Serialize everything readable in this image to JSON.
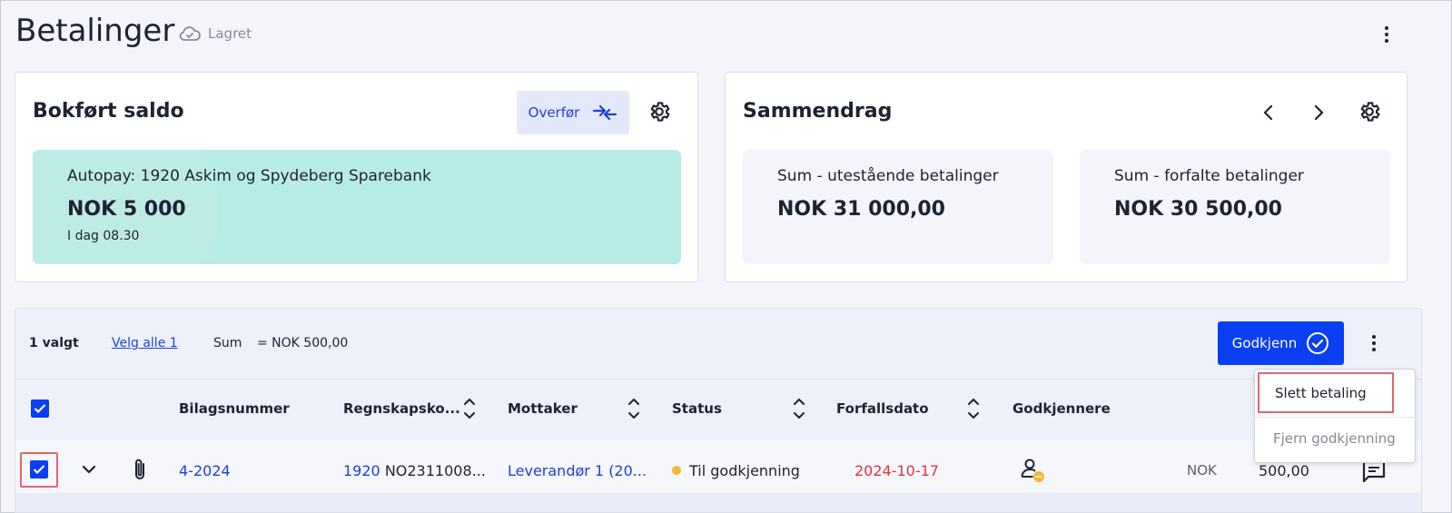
{
  "header": {
    "title": "Betalinger",
    "saved_status": "Lagret"
  },
  "balance_card": {
    "title": "Bokført saldo",
    "transfer_label": "Overfør",
    "bank_name": "Autopay: 1920 Askim og Spydeberg Sparebank",
    "amount": "NOK 5 000",
    "time": "I dag 08.30"
  },
  "summary_card": {
    "title": "Sammendrag",
    "outstanding_label": "Sum - utestående betalinger",
    "outstanding_value": "NOK 31 000,00",
    "overdue_label": "Sum - forfalte betalinger",
    "overdue_value": "NOK 30 500,00"
  },
  "toolbar": {
    "selected_count": "1 valgt",
    "select_all": "Velg alle 1",
    "sum_label": "Sum",
    "sum_value": "= NOK 500,00",
    "approve_label": "Godkjenn"
  },
  "table": {
    "headers": [
      "Bilagsnummer",
      "Regnskapsko...",
      "Mottaker",
      "Status",
      "Forfallsdato",
      "Godkjennere"
    ],
    "row": {
      "voucher": "4-2024",
      "account_number": "1920",
      "account_rest": "NO2311008...",
      "recipient": "Leverandør 1 (20...",
      "status": "Til godkjenning",
      "due_date": "2024-10-17",
      "currency": "NOK",
      "amount": "500,00"
    }
  },
  "menu": {
    "delete_payment": "Slett betaling",
    "remove_approval": "Fjern godkjenning"
  },
  "colors": {
    "primary": "#0b3ff2",
    "link": "#1d3fd8",
    "due_date": "#e0343f",
    "status_dot": "#f4b731",
    "bank_box": "#b7ebe5"
  }
}
